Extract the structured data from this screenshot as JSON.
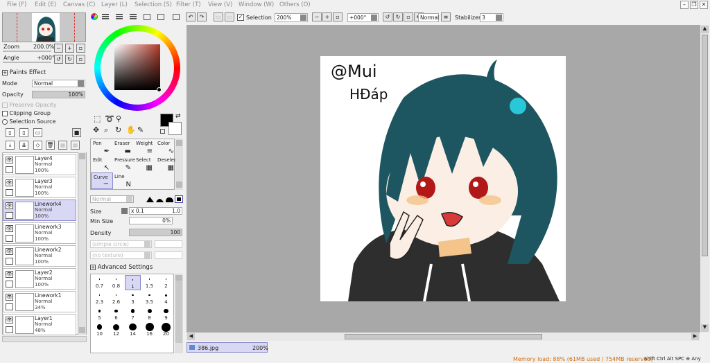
{
  "menu": [
    "File (F)",
    "Edit (E)",
    "Canvas (C)",
    "Layer (L)",
    "Selection (S)",
    "Filter (T)",
    "View (V)",
    "Window (W)",
    "Others (O)"
  ],
  "nav": {
    "zoom_label": "Zoom",
    "zoom_value": "200.0%",
    "angle_label": "Angle",
    "angle_value": "+000°"
  },
  "paints": {
    "title": "Paints Effect",
    "mode_label": "Mode",
    "mode_value": "Normal",
    "opacity_label": "Opacity",
    "opacity_value": "100%",
    "preserve": "Preserve Opacity",
    "clipping": "Clipping Group",
    "selsource": "Selection Source"
  },
  "layers": [
    {
      "name": "Layer4",
      "mode": "Normal",
      "opacity": "100%"
    },
    {
      "name": "Layer3",
      "mode": "Normal",
      "opacity": "100%"
    },
    {
      "name": "Linework4",
      "mode": "Normal",
      "opacity": "100%"
    },
    {
      "name": "Linework3",
      "mode": "Normal",
      "opacity": "100%"
    },
    {
      "name": "Linework2",
      "mode": "Normal",
      "opacity": "100%"
    },
    {
      "name": "Layer2",
      "mode": "Normal",
      "opacity": "100%"
    },
    {
      "name": "Linework1",
      "mode": "Normal",
      "opacity": "34%"
    },
    {
      "name": "Layer1",
      "mode": "Normal",
      "opacity": "48%"
    }
  ],
  "tools": [
    {
      "label": "Pen",
      "icon": "✒"
    },
    {
      "label": "Eraser",
      "icon": "▬"
    },
    {
      "label": "Weight",
      "icon": "≡"
    },
    {
      "label": "Color",
      "icon": "∿"
    },
    {
      "label": "Edit",
      "icon": "↖"
    },
    {
      "label": "Pressure",
      "icon": "✎"
    },
    {
      "label": "Select",
      "icon": "▦"
    },
    {
      "label": "Deselect",
      "icon": "▦"
    },
    {
      "label": "Curve",
      "icon": "∽"
    },
    {
      "label": "Line",
      "icon": "N"
    }
  ],
  "brush": {
    "blend": "Normal",
    "size_label": "Size",
    "size_mult": "x 0.1",
    "size_value": "1.0",
    "minsize_label": "Min Size",
    "minsize_value": "0%",
    "density_label": "Density",
    "density_value": "100",
    "simple": "(simple circle)",
    "notexture": "(no texture)",
    "adv": "Advanced Settings"
  },
  "brushsizes": [
    "0.7",
    "0.8",
    "1",
    "1.5",
    "2",
    "2.3",
    "2.6",
    "3",
    "3.5",
    "4",
    "5",
    "6",
    "7",
    "8",
    "9",
    "10",
    "12",
    "14",
    "16",
    "20"
  ],
  "toolbar": {
    "selection": "Selection",
    "zoom": "200%",
    "angle": "+000°",
    "mode": "Normal",
    "stabilizer_label": "Stabilizer",
    "stabilizer_value": "3"
  },
  "art": {
    "text1": "@Mui",
    "text2": "HĐáp"
  },
  "doc": {
    "tab": "386.jpg",
    "zoom": "200%"
  },
  "status": {
    "memory": "Memory load: 88% (61MB used / 754MB reserved)",
    "keys": "Shift Ctrl Alt SPC ⊕ Any"
  },
  "colors": {
    "accent": "#8888cc",
    "hair": "#1d5660",
    "hoodie": "#2e2e2e",
    "selected_layer": "#d8d8f4"
  }
}
